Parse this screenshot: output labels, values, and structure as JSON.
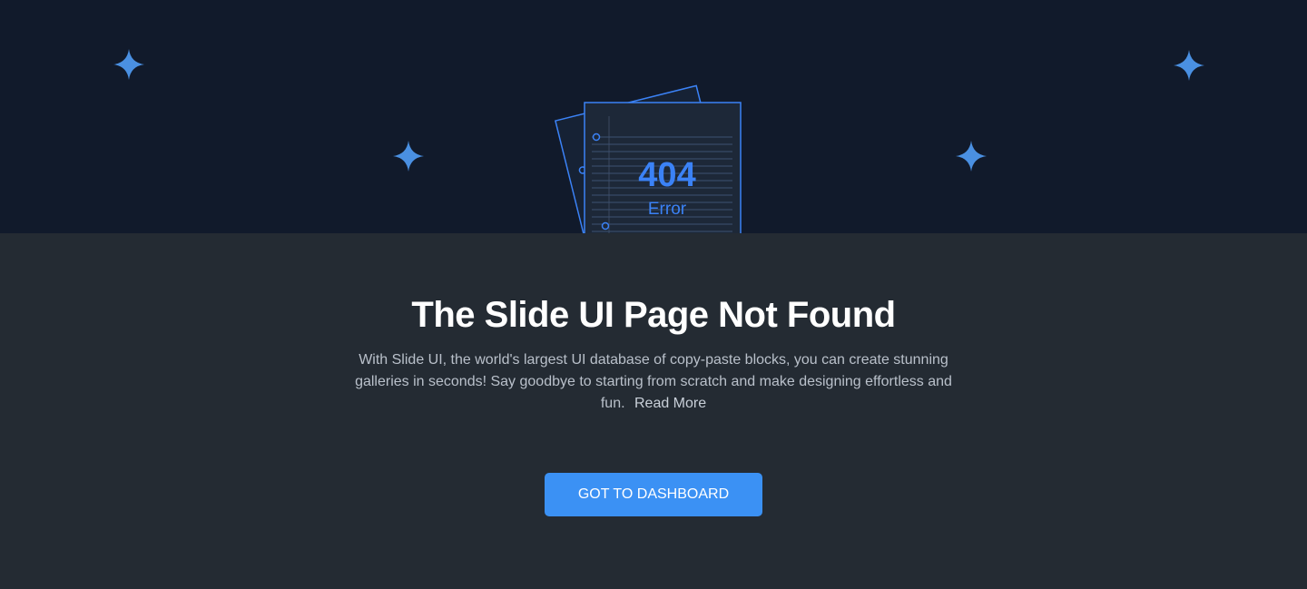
{
  "illustration": {
    "code": "404",
    "label": "Error",
    "accent_color": "#3b82f6"
  },
  "heading": "The Slide UI Page Not Found",
  "description": {
    "text": "With Slide UI, the world's largest UI database of copy-paste blocks, you can create stunning galleries in seconds! Say goodbye to starting from scratch and make designing effortless and fun.",
    "link_label": "Read More"
  },
  "button": {
    "label": "GOT TO DASHBOARD",
    "color": "#3b91f4"
  },
  "colors": {
    "hero_background": "#111a2b",
    "page_background": "#242b33",
    "sparkle": "#4a90e2"
  }
}
